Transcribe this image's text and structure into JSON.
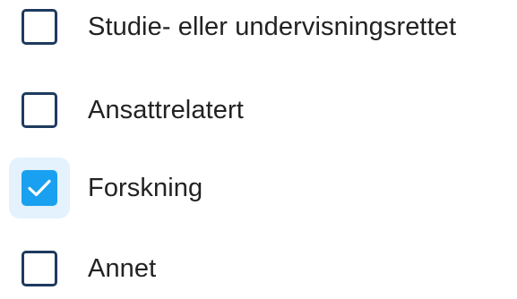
{
  "options": [
    {
      "label": "Studie- eller undervisningsrettet",
      "checked": false
    },
    {
      "label": "Ansattrelatert",
      "checked": false
    },
    {
      "label": "Forskning",
      "checked": true
    },
    {
      "label": "Annet",
      "checked": false
    }
  ],
  "colors": {
    "checkbox_border": "#1e3a5f",
    "checkbox_checked_fill": "#1aa0f0",
    "focus_highlight": "#e3f2fd",
    "label_text": "#222222"
  },
  "icons": {
    "check": "check-icon"
  }
}
